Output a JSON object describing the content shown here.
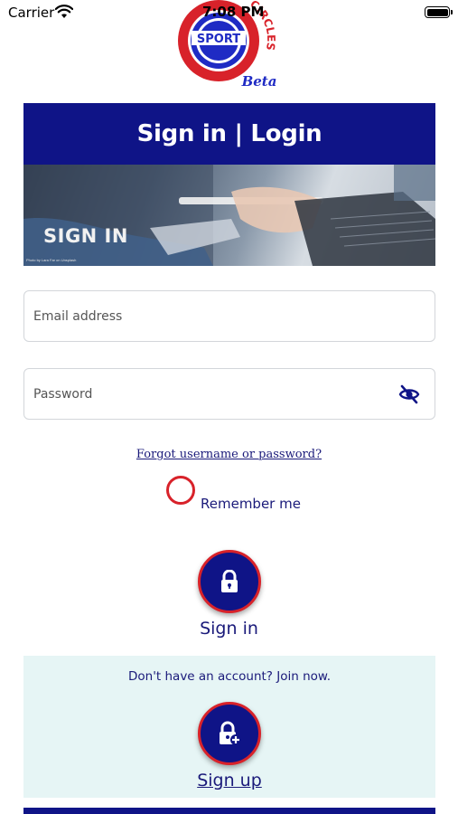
{
  "status_bar": {
    "carrier": "Carrier",
    "time": "7:08 PM"
  },
  "logo": {
    "word_main": "SPORT",
    "word_circle": "CIRCLES",
    "badge": "Beta",
    "colors": {
      "red": "#d8222a",
      "blue": "#1f2bc4",
      "navy": "#0f1487"
    }
  },
  "header": {
    "title": "Sign in | Login"
  },
  "hero": {
    "caption": "SIGN IN",
    "credit": "Photo by Lara Far on Unsplash"
  },
  "form": {
    "email_placeholder": "Email address",
    "email_value": "",
    "password_placeholder": "Password",
    "password_value": "",
    "password_toggle_icon": "eye-slash-icon",
    "forgot_link": "Forgot username or password?",
    "remember_label": "Remember me",
    "remember_checked": false
  },
  "signin": {
    "icon": "lock-icon",
    "label": "Sign in"
  },
  "signup": {
    "prompt": "Don't have an account? Join now.",
    "icon": "lock-plus-icon",
    "label": "Sign up"
  },
  "theme": {
    "navy": "#0f1487",
    "accent_red": "#d8222a",
    "panel_bg": "#e6f5f5",
    "text": "#1a1a7a"
  }
}
